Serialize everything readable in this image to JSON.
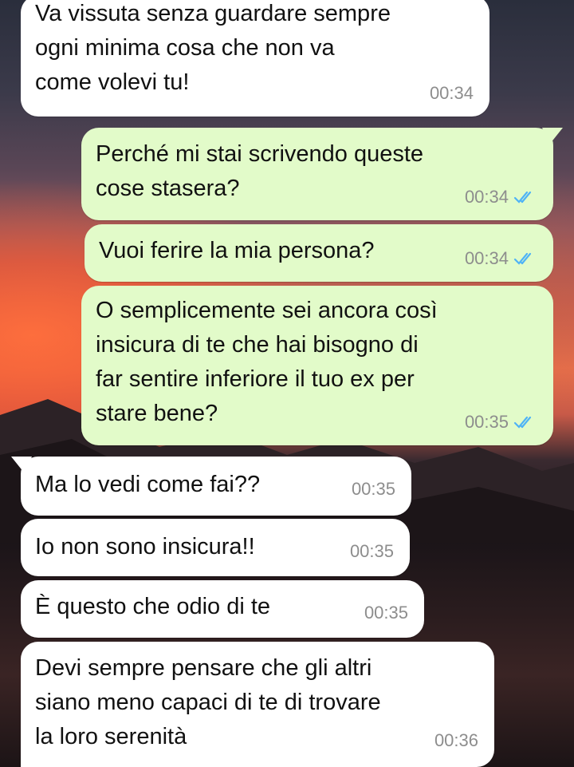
{
  "colors": {
    "incoming_bubble": "#ffffff",
    "outgoing_bubble": "#e2fbc9",
    "timestamp": "#8d8d8d",
    "read_ticks": "#4fb3f6"
  },
  "messages": [
    {
      "direction": "incoming",
      "text": "Va vissuta senza guardare sempre\nogni minima cosa che non va\ncome volevi tu!",
      "time": "00:34"
    },
    {
      "direction": "outgoing",
      "text": "Perché mi stai scrivendo queste\ncose stasera?",
      "time": "00:34",
      "status_icon": "double-check-read-icon"
    },
    {
      "direction": "outgoing",
      "text": "Vuoi ferire la mia persona?",
      "time": "00:34",
      "status_icon": "double-check-read-icon"
    },
    {
      "direction": "outgoing",
      "text": "O semplicemente sei ancora così\ninsicura di te che hai bisogno di\nfar sentire inferiore il tuo ex per\nstare bene?",
      "time": "00:35",
      "status_icon": "double-check-read-icon"
    },
    {
      "direction": "incoming",
      "text": "Ma lo vedi come fai??",
      "time": "00:35"
    },
    {
      "direction": "incoming",
      "text": "Io non sono insicura!!",
      "time": "00:35"
    },
    {
      "direction": "incoming",
      "text": "È questo che odio di te",
      "time": "00:35"
    },
    {
      "direction": "incoming",
      "text": "Devi sempre pensare che gli altri\nsiano meno capaci di te di trovare\nla loro serenità",
      "time": "00:36"
    }
  ]
}
